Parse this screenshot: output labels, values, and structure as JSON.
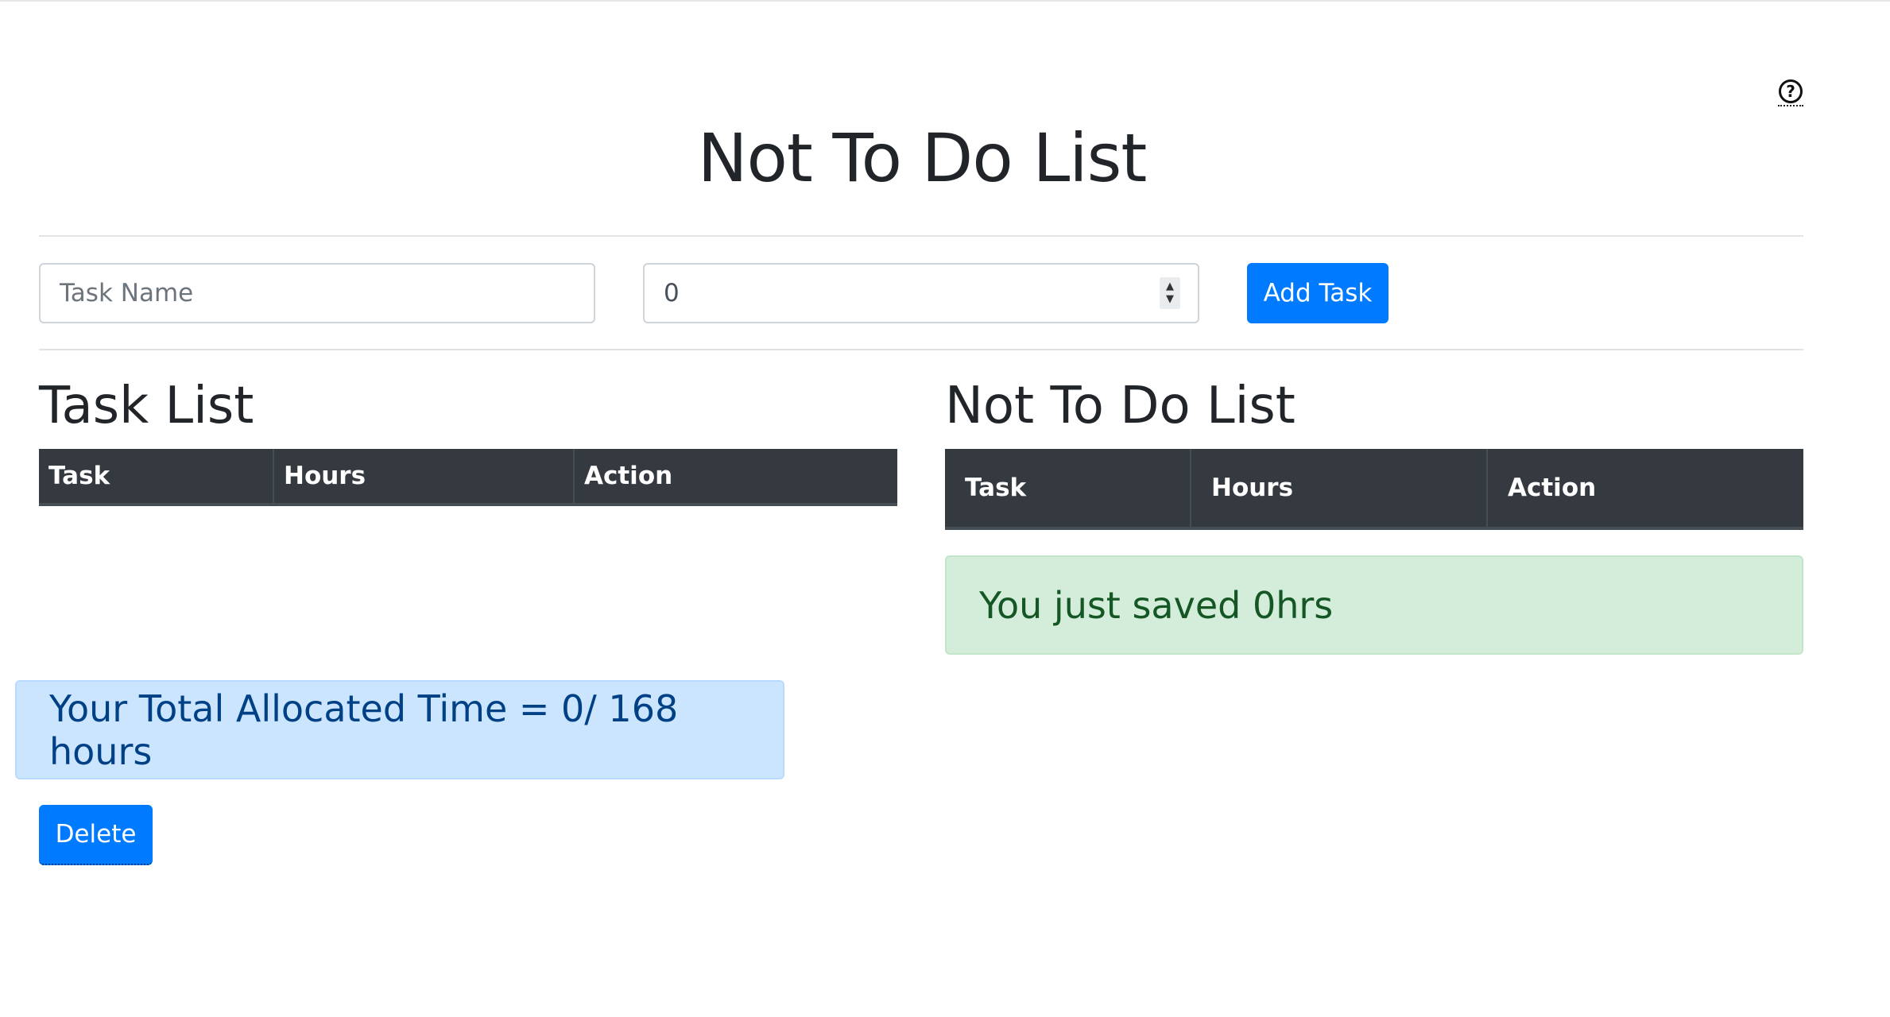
{
  "header": {
    "help_icon": "question-circle-icon",
    "help_symbol": "?",
    "title": "Not To Do List"
  },
  "form": {
    "task_name_placeholder": "Task Name",
    "hours_value": "0",
    "add_button_label": "Add Task"
  },
  "task_list": {
    "title": "Task List",
    "columns": [
      "Task",
      "Hours",
      "Action"
    ]
  },
  "not_todo_list": {
    "title": "Not To Do List",
    "columns": [
      "Task",
      "Hours",
      "Action"
    ],
    "saved_message": "You just saved 0hrs"
  },
  "summary": {
    "total_message": "Your Total Allocated Time = 0/ 168 hours",
    "delete_button_label": "Delete"
  },
  "colors": {
    "primary": "#007bff",
    "table_header": "#343a40",
    "success_bg": "#d4edda",
    "info_bg": "#cce5ff"
  }
}
